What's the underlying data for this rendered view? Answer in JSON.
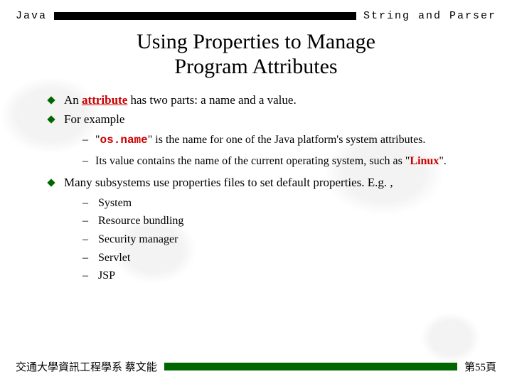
{
  "header": {
    "left": "Java",
    "right": "String and Parser"
  },
  "title_line1": "Using Properties to Manage",
  "title_line2": "Program Attributes",
  "bullets": {
    "b1_pre": "An ",
    "b1_attr": "attribute",
    "b1_post": " has two parts: a name and a value.",
    "b2": "For example",
    "b2_s1_q1": "\"",
    "b2_s1_code": "os.name",
    "b2_s1_post": "\" is the name for one of the Java platform's system attributes.",
    "b2_s2_pre": "Its value contains the name of the current operating system, such as \"",
    "b2_s2_linux": "Linux",
    "b2_s2_post": "\".",
    "b3": "Many subsystems use properties files to set default properties. E.g. ,",
    "b3_items": {
      "i1": "System",
      "i2": "Resource bundling",
      "i3": "Security manager",
      "i4": "Servlet",
      "i5": "JSP"
    }
  },
  "footer": {
    "left": "交通大學資訊工程學系 蔡文能",
    "right": "第55頁"
  }
}
